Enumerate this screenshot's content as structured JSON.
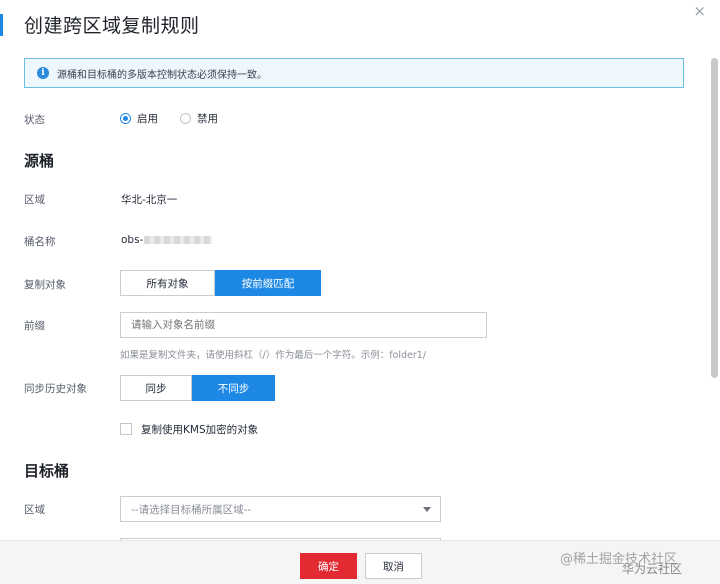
{
  "dialog": {
    "title": "创建跨区域复制规则",
    "close_glyph": "×"
  },
  "notice": {
    "icon_glyph": "i",
    "text": "源桶和目标桶的多版本控制状态必须保持一致。"
  },
  "status": {
    "label": "状态",
    "options": [
      {
        "label": "启用",
        "checked": true
      },
      {
        "label": "禁用",
        "checked": false
      }
    ]
  },
  "source": {
    "heading": "源桶",
    "region_label": "区域",
    "region_value": "华北-北京一",
    "bucket_label": "桶名称",
    "bucket_value": "obs-",
    "object_label": "复制对象",
    "object_options": [
      "所有对象",
      "按前缀匹配"
    ],
    "object_selected": 1,
    "prefix_label": "前缀",
    "prefix_placeholder": "请输入对象名前缀",
    "prefix_hint": "如果是复制文件夹，请使用斜杠（/）作为最后一个字符。示例：folder1/",
    "history_label": "同步历史对象",
    "history_options": [
      "同步",
      "不同步"
    ],
    "history_selected": 1,
    "kms_label": "复制使用KMS加密的对象",
    "kms_checked": false
  },
  "target": {
    "heading": "目标桶",
    "region_label": "区域",
    "region_placeholder": "--请选择目标桶所属区域--"
  },
  "footer": {
    "ok_label": "确定",
    "cancel_label": "取消"
  },
  "watermark": {
    "line1": "@稀土掘金技术社区",
    "line2": "华为云社区"
  },
  "colors": {
    "accent": "#1e88e5",
    "danger": "#e32932",
    "notice_bg": "#eef7fd",
    "notice_border": "#6cbfe2"
  }
}
